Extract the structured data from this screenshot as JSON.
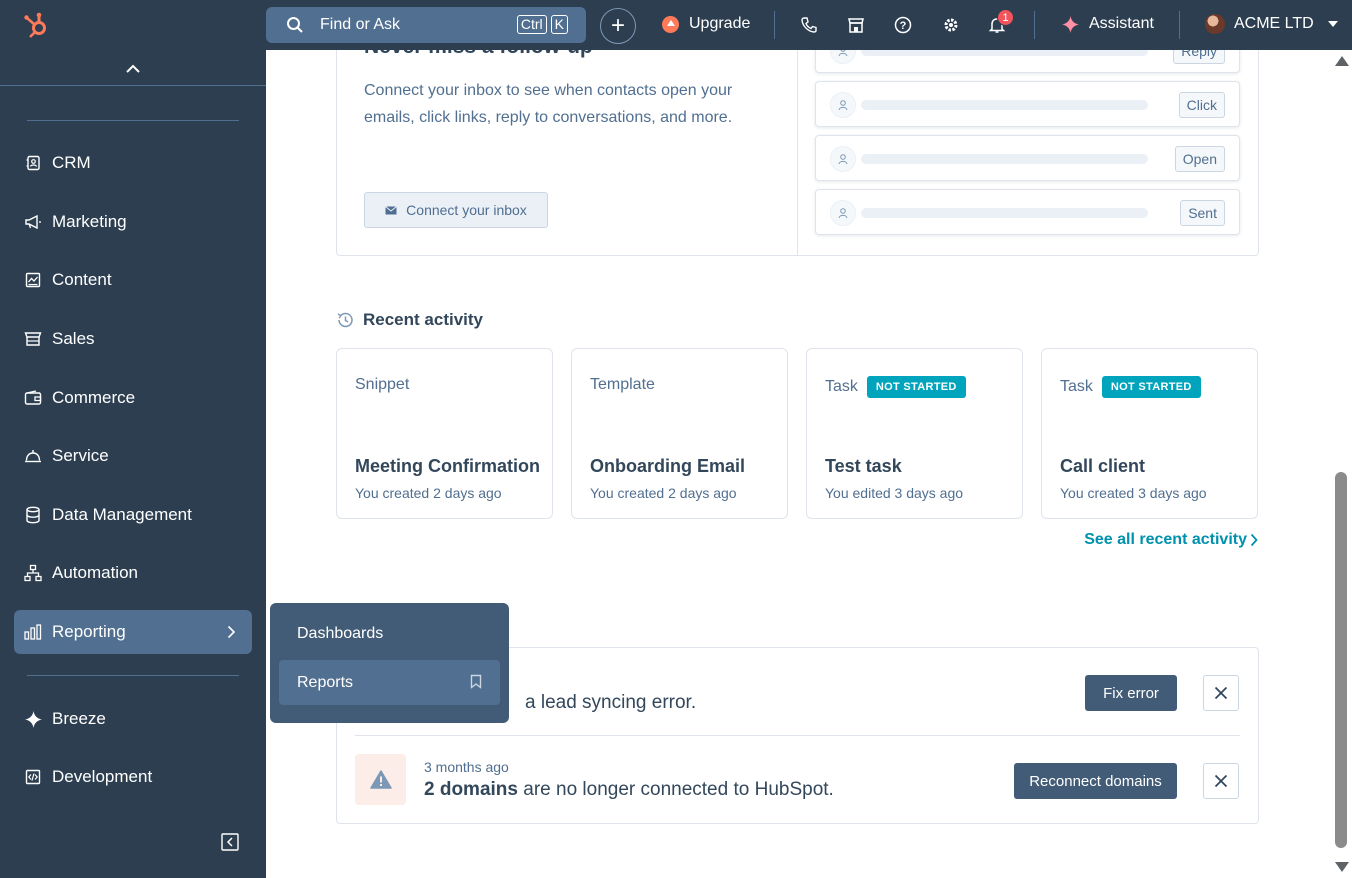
{
  "topbar": {
    "search_placeholder": "Find or Ask",
    "kbd1": "Ctrl",
    "kbd2": "K",
    "plus": "+",
    "upgrade": "Upgrade",
    "notifications_count": "1",
    "assistant": "Assistant",
    "account": "ACME LTD"
  },
  "sidebar": {
    "items": [
      {
        "label": "CRM",
        "icon": "contacts-icon"
      },
      {
        "label": "Marketing",
        "icon": "megaphone-icon"
      },
      {
        "label": "Content",
        "icon": "content-icon"
      },
      {
        "label": "Sales",
        "icon": "sales-icon"
      },
      {
        "label": "Commerce",
        "icon": "wallet-icon"
      },
      {
        "label": "Service",
        "icon": "bell-service-icon"
      },
      {
        "label": "Data Management",
        "icon": "database-icon"
      },
      {
        "label": "Automation",
        "icon": "automation-icon"
      },
      {
        "label": "Reporting",
        "icon": "bar-chart-icon"
      },
      {
        "label": "Breeze",
        "icon": "sparkle-icon"
      },
      {
        "label": "Development",
        "icon": "code-icon"
      }
    ]
  },
  "flyout": {
    "items": [
      {
        "label": "Dashboards"
      },
      {
        "label": "Reports"
      }
    ]
  },
  "inbox_card": {
    "title": "Never miss a follow-up",
    "description": "Connect your inbox to see when contacts open your emails, click links, reply to conversations, and more.",
    "button": "Connect your inbox",
    "events": [
      "Reply",
      "Click",
      "Open",
      "Sent"
    ]
  },
  "recent_activity": {
    "heading": "Recent activity",
    "cards": [
      {
        "type": "Snippet",
        "status": "",
        "title": "Meeting Confirmation",
        "sub": "You created 2 days ago"
      },
      {
        "type": "Template",
        "status": "",
        "title": "Onboarding Email",
        "sub": "You created 2 days ago"
      },
      {
        "type": "Task",
        "status": "NOT STARTED",
        "title": "Test task",
        "sub": "You edited 3 days ago"
      },
      {
        "type": "Task",
        "status": "NOT STARTED",
        "title": "Call client",
        "sub": "You created 3 days ago"
      }
    ],
    "see_all": "See all recent activity"
  },
  "alerts": {
    "row1_text": "a lead syncing error.",
    "row1_button": "Fix error",
    "row2_time": "3 months ago",
    "row2_bold": "2 domains",
    "row2_text": " are no longer connected to HubSpot.",
    "row2_button": "Reconnect domains"
  },
  "colors": {
    "nav_bg": "#2d3e50",
    "accent_orange": "#ff7a59",
    "teal": "#00a4bd",
    "link": "#0091ae"
  }
}
